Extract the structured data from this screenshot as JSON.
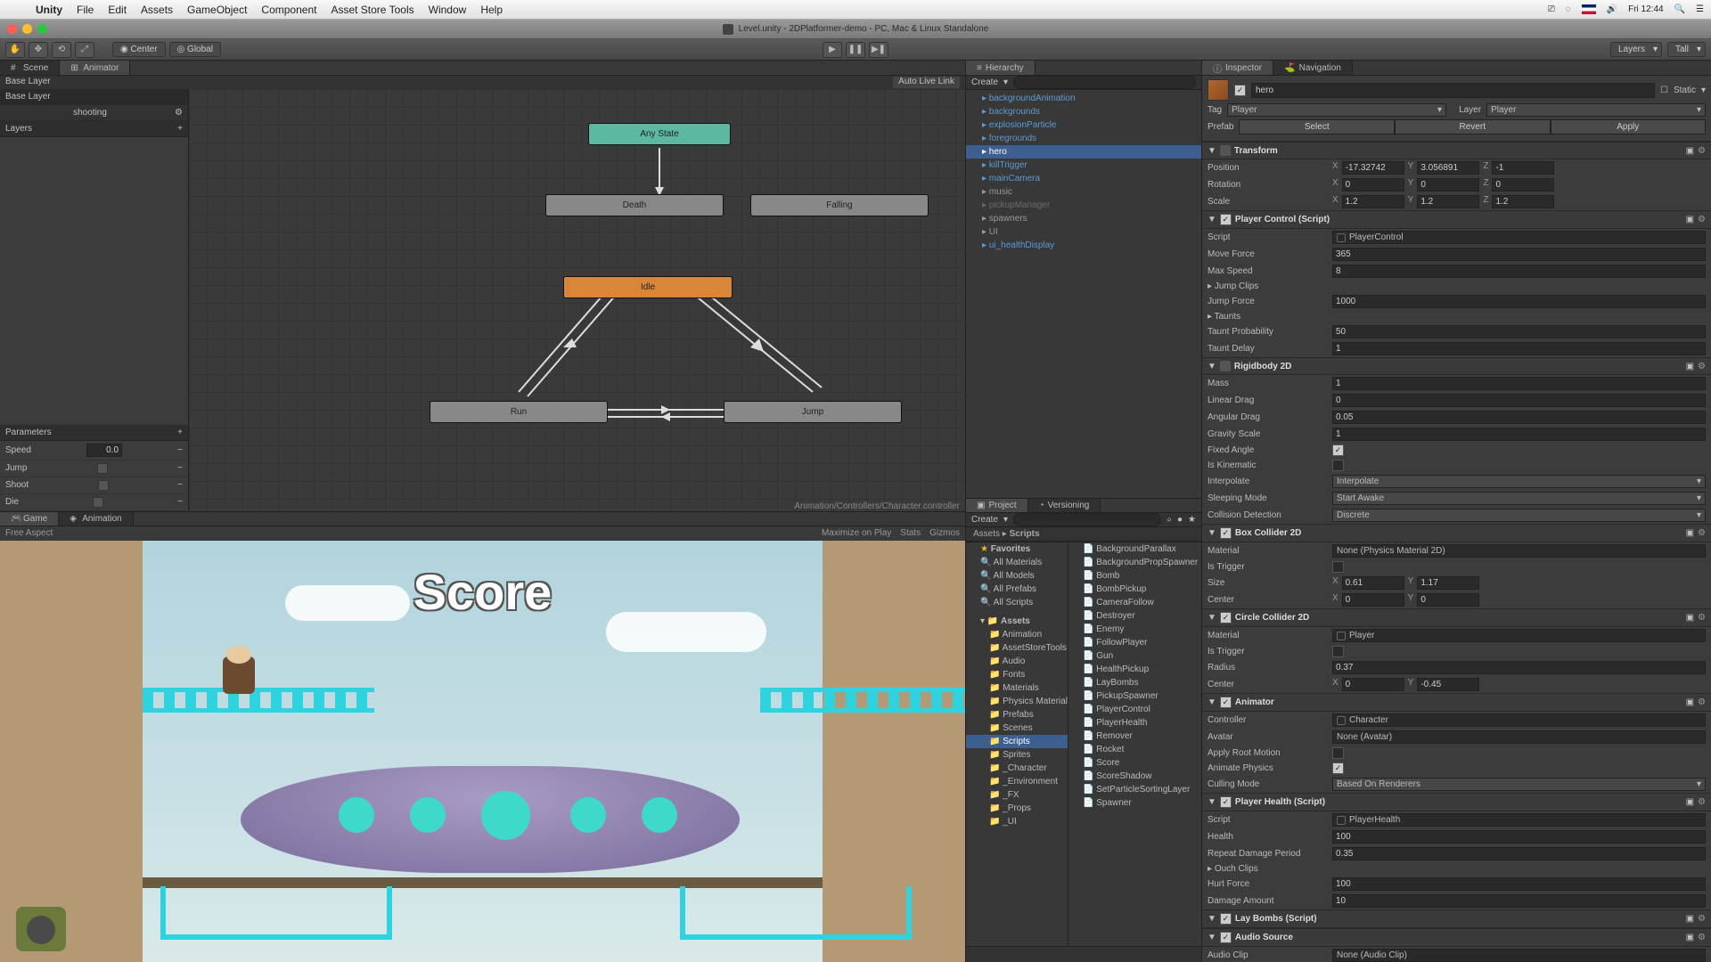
{
  "menubar": {
    "app": "Unity",
    "items": [
      "File",
      "Edit",
      "Assets",
      "GameObject",
      "Component",
      "Asset Store Tools",
      "Window",
      "Help"
    ],
    "clock": "Fri 12:44"
  },
  "window": {
    "title": "Level.unity - 2DPlatformer-demo - PC, Mac & Linux Standalone"
  },
  "toolbar": {
    "center": "Center",
    "global": "Global",
    "layers_dd": "Layers",
    "layout_dd": "Tall"
  },
  "left_tabs": {
    "scene": "Scene",
    "animator": "Animator",
    "base_layer_crumb": "Base Layer",
    "auto_live": "Auto Live Link"
  },
  "animator": {
    "layers_hdr": "Layers",
    "layers": [
      "Base Layer",
      "shooting"
    ],
    "params_hdr": "Parameters",
    "params": [
      {
        "name": "Speed",
        "val": "0.0",
        "type": "float"
      },
      {
        "name": "Jump",
        "type": "bool"
      },
      {
        "name": "Shoot",
        "type": "bool"
      },
      {
        "name": "Die",
        "type": "bool"
      }
    ],
    "states": {
      "any": "Any State",
      "death": "Death",
      "falling": "Falling",
      "idle": "Idle",
      "run": "Run",
      "jump": "Jump"
    },
    "asset_path": "Animation/Controllers/Character.controller"
  },
  "lower_tabs": {
    "game": "Game",
    "animation": "Animation"
  },
  "game_bar": {
    "aspect": "Free Aspect",
    "max": "Maximize on Play",
    "stats": "Stats",
    "gizmos": "Gizmos"
  },
  "game": {
    "score": "Score"
  },
  "hierarchy": {
    "title": "Hierarchy",
    "create": "Create",
    "items": [
      {
        "n": "backgroundAnimation",
        "c": "blue"
      },
      {
        "n": "backgrounds",
        "c": "blue"
      },
      {
        "n": "explosionParticle",
        "c": "blue"
      },
      {
        "n": "foregrounds",
        "c": "blue"
      },
      {
        "n": "hero",
        "c": "sel"
      },
      {
        "n": "killTrigger",
        "c": "blue"
      },
      {
        "n": "mainCamera",
        "c": "blue"
      },
      {
        "n": "music",
        "c": "grey"
      },
      {
        "n": "pickupManager",
        "c": "dim"
      },
      {
        "n": "spawners",
        "c": "grey"
      },
      {
        "n": "UI",
        "c": "grey"
      },
      {
        "n": "ui_healthDisplay",
        "c": "blue"
      }
    ]
  },
  "project": {
    "title": "Project",
    "versioning": "Versioning",
    "create": "Create",
    "favorites_hdr": "Favorites",
    "favorites": [
      "All Materials",
      "All Models",
      "All Prefabs",
      "All Scripts"
    ],
    "assets_hdr": "Assets",
    "folders": [
      "Animation",
      "AssetStoreTools",
      "Audio",
      "Fonts",
      "Materials",
      "Physics Materials",
      "Prefabs",
      "Scenes",
      "Scripts",
      "Sprites",
      "_Character",
      "_Environment",
      "_FX",
      "_Props",
      "_UI"
    ],
    "selected_folder": "Scripts",
    "crumb_assets": "Assets",
    "crumb_sep": "▸",
    "crumb_scripts": "Scripts",
    "files": [
      "BackgroundParallax",
      "BackgroundPropSpawner",
      "Bomb",
      "BombPickup",
      "CameraFollow",
      "Destroyer",
      "Enemy",
      "FollowPlayer",
      "Gun",
      "HealthPickup",
      "LayBombs",
      "PickupSpawner",
      "PlayerControl",
      "PlayerHealth",
      "Remover",
      "Rocket",
      "Score",
      "ScoreShadow",
      "SetParticleSortingLayer",
      "Spawner"
    ]
  },
  "inspector": {
    "title": "Inspector",
    "navigation": "Navigation",
    "name": "hero",
    "static": "Static",
    "tag_lbl": "Tag",
    "tag": "Player",
    "layer_lbl": "Layer",
    "layer": "Player",
    "prefab_lbl": "Prefab",
    "select": "Select",
    "revert": "Revert",
    "apply": "Apply",
    "transform": {
      "hdr": "Transform",
      "pos": "Position",
      "rot": "Rotation",
      "scale": "Scale",
      "px": "-17.32742",
      "py": "3.056891",
      "pz": "-1",
      "rx": "0",
      "ry": "0",
      "rz": "0",
      "sx": "1.2",
      "sy": "1.2",
      "sz": "1.2"
    },
    "playerControl": {
      "hdr": "Player Control (Script)",
      "script_lbl": "Script",
      "script": "PlayerControl",
      "moveForce_lbl": "Move Force",
      "moveForce": "365",
      "maxSpeed_lbl": "Max Speed",
      "maxSpeed": "8",
      "jumpClips_lbl": "Jump Clips",
      "jumpForce_lbl": "Jump Force",
      "jumpForce": "1000",
      "taunts_lbl": "Taunts",
      "tauntProb_lbl": "Taunt Probability",
      "tauntProb": "50",
      "tauntDelay_lbl": "Taunt Delay",
      "tauntDelay": "1"
    },
    "rigidbody": {
      "hdr": "Rigidbody 2D",
      "mass_lbl": "Mass",
      "mass": "1",
      "ldrag_lbl": "Linear Drag",
      "ldrag": "0",
      "adrag_lbl": "Angular Drag",
      "adrag": "0.05",
      "gscale_lbl": "Gravity Scale",
      "gscale": "1",
      "fixed_lbl": "Fixed Angle",
      "kine_lbl": "Is Kinematic",
      "interp_lbl": "Interpolate",
      "interp": "Interpolate",
      "sleep_lbl": "Sleeping Mode",
      "sleep": "Start Awake",
      "coll_lbl": "Collision Detection",
      "coll": "Discrete"
    },
    "box": {
      "hdr": "Box Collider 2D",
      "mat_lbl": "Material",
      "mat": "None (Physics Material 2D)",
      "trig_lbl": "Is Trigger",
      "size_lbl": "Size",
      "sx": "0.61",
      "sy": "1.17",
      "center_lbl": "Center",
      "cx": "0",
      "cy": "0"
    },
    "circle": {
      "hdr": "Circle Collider 2D",
      "mat_lbl": "Material",
      "mat": "Player",
      "trig_lbl": "Is Trigger",
      "radius_lbl": "Radius",
      "radius": "0.37",
      "center_lbl": "Center",
      "cx": "0",
      "cy": "-0.45"
    },
    "animator": {
      "hdr": "Animator",
      "ctrl_lbl": "Controller",
      "ctrl": "Character",
      "avatar_lbl": "Avatar",
      "avatar": "None (Avatar)",
      "root_lbl": "Apply Root Motion",
      "phys_lbl": "Animate Physics",
      "cull_lbl": "Culling Mode",
      "cull": "Based On Renderers"
    },
    "health": {
      "hdr": "Player Health (Script)",
      "script_lbl": "Script",
      "script": "PlayerHealth",
      "health_lbl": "Health",
      "health": "100",
      "repeat_lbl": "Repeat Damage Period",
      "repeat": "0.35",
      "ouch_lbl": "Ouch Clips",
      "hurt_lbl": "Hurt Force",
      "hurt": "100",
      "dmg_lbl": "Damage Amount",
      "dmg": "10"
    },
    "laybombs": {
      "hdr": "Lay Bombs (Script)"
    },
    "audio": {
      "hdr": "Audio Source",
      "clip_lbl": "Audio Clip",
      "clip": "None (Audio Clip)"
    }
  }
}
